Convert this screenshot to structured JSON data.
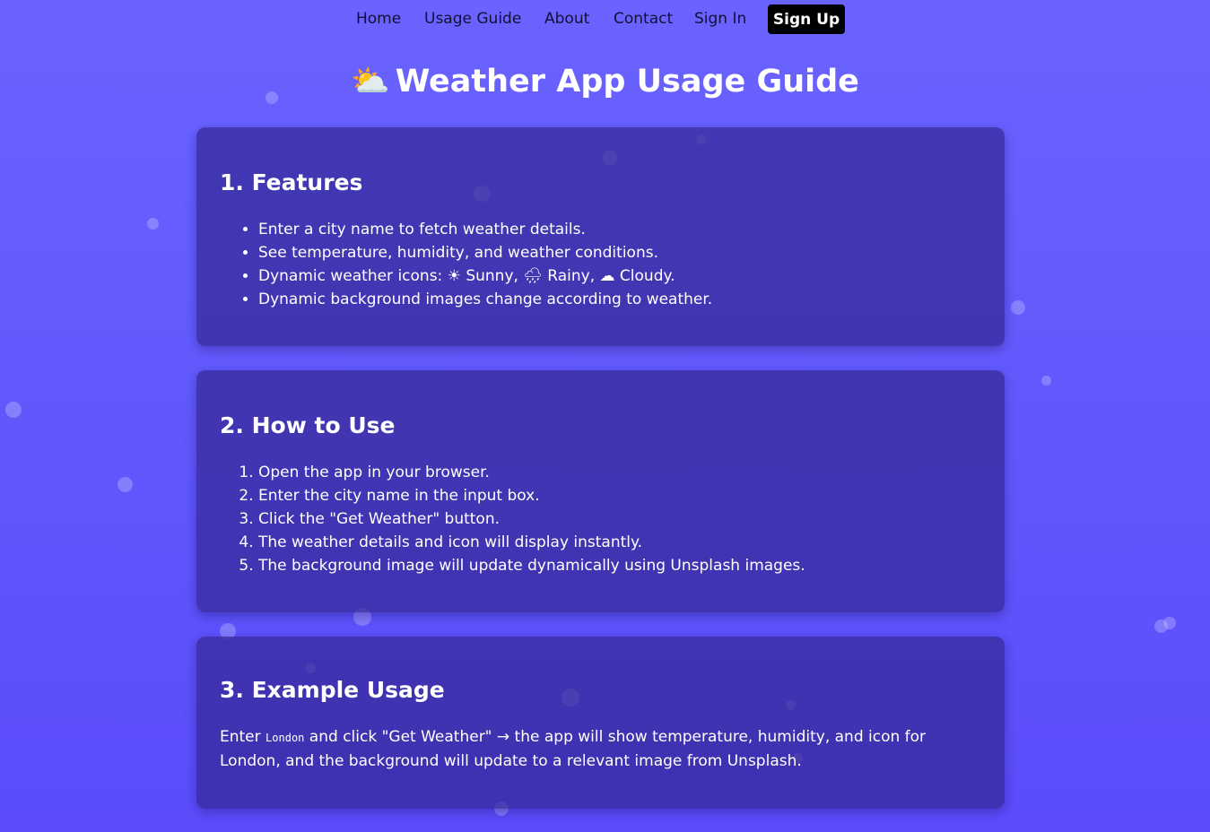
{
  "nav": {
    "home": "Home",
    "usage_guide": "Usage Guide",
    "about": "About",
    "contact": "Contact",
    "sign_in": "Sign In",
    "sign_up": "Sign Up"
  },
  "title": {
    "icon": "⛅",
    "text": "Weather App Usage Guide"
  },
  "features": {
    "heading": "1. Features",
    "items": [
      "Enter a city name to fetch weather details.",
      "See temperature, humidity, and weather conditions.",
      "Dynamic weather icons: ☀ Sunny, 🌧 Rainy, ☁ Cloudy.",
      "Dynamic background images change according to weather."
    ]
  },
  "how_to_use": {
    "heading": "2. How to Use",
    "steps": [
      "Open the app in your browser.",
      "Enter the city name in the input box.",
      "Click the \"Get Weather\" button.",
      "The weather details and icon will display instantly.",
      "The background image will update dynamically using Unsplash images."
    ]
  },
  "example": {
    "heading": "3. Example Usage",
    "text_before": "Enter ",
    "code": "London",
    "text_after": " and click \"Get Weather\" → the app will show temperature, humidity, and icon for London, and the background will update to a relevant image from Unsplash."
  },
  "colors": {
    "background_top": "#6a63ff",
    "background_bottom": "#5a4cfb",
    "card": "#3a2d9e",
    "signup_button": "#000000"
  }
}
